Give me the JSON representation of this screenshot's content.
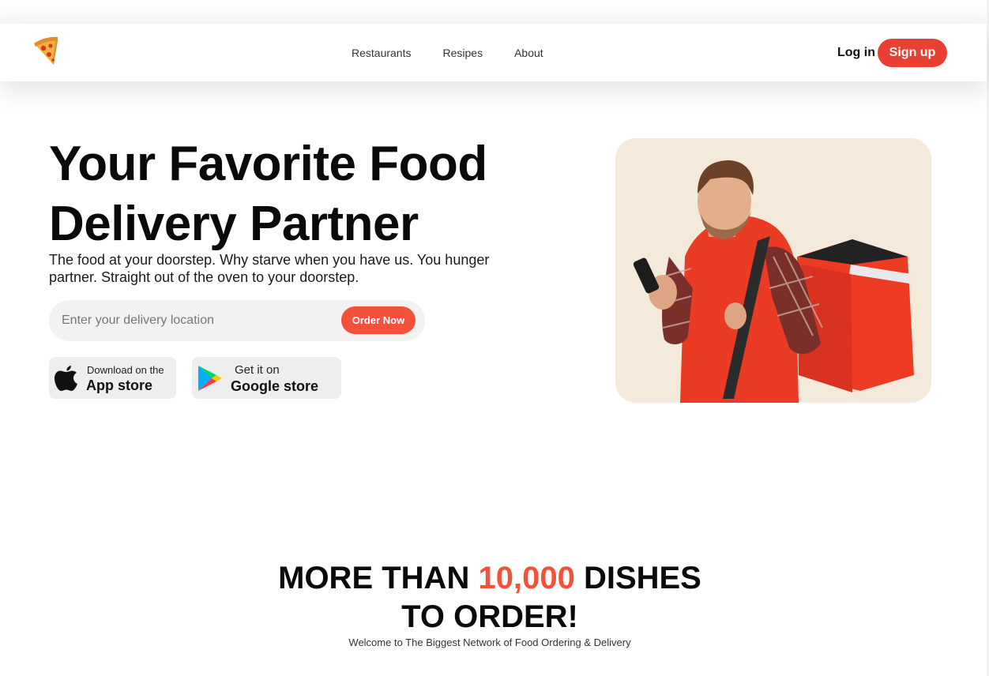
{
  "nav": {
    "logo_icon": "pizza-slice-icon",
    "links": [
      "Restaurants",
      "Resipes",
      "About"
    ],
    "login_label": "Log in",
    "signup_label": "Sign up",
    "accent_color": "#ea3f33"
  },
  "hero": {
    "title_line1": "Your Favorite Food",
    "title_line2": "Delivery Partner",
    "subtitle": "The food at your doorstep. Why starve when you have us. You hunger partner. Straight out of the oven to your doorstep.",
    "search_placeholder": "Enter your delivery location",
    "order_button": "Order Now",
    "image": "delivery-man-with-red-backpack"
  },
  "stores": {
    "app_store": {
      "line1": "Download on the",
      "line2": "App store",
      "icon": "apple-icon"
    },
    "google_store": {
      "line1": "Get it on",
      "line2": "Google store",
      "icon": "google-play-icon"
    }
  },
  "dishes": {
    "title_prefix": "MORE THAN",
    "title_number": "10,000",
    "title_suffix": "DISHES",
    "title_line2": "TO ORDER!",
    "welcome": "Welcome to The Biggest Network of Food Ordering & Delivery",
    "accent_color": "#f4513a"
  }
}
